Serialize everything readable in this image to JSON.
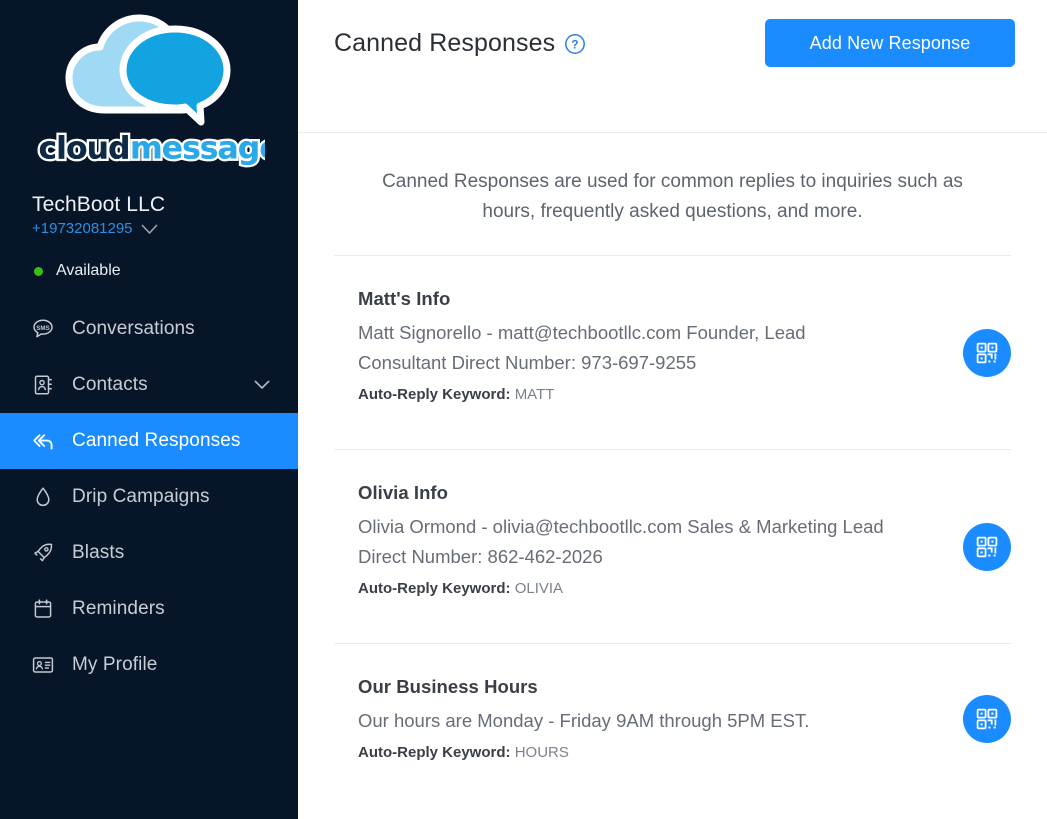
{
  "brand": {
    "logo_text_cloud": "cloud",
    "logo_text_message": "message",
    "logo_icon": "cloud-chat-logo",
    "accent_blue": "#1a8cff",
    "logo_light_blue": "#9ed9f5",
    "logo_dark_blue": "#0e2a47"
  },
  "sidebar": {
    "account_name": "TechBoot LLC",
    "account_phone": "+19732081295",
    "phone_chevron_icon": "chevron-down-icon",
    "status_label": "Available",
    "status_color": "#39c016",
    "items": [
      {
        "label": "Conversations",
        "icon": "sms-chat-icon",
        "active": false,
        "has_chevron": false
      },
      {
        "label": "Contacts",
        "icon": "address-book-icon",
        "active": false,
        "has_chevron": true
      },
      {
        "label": "Canned Responses",
        "icon": "reply-all-icon",
        "active": true,
        "has_chevron": false
      },
      {
        "label": "Drip Campaigns",
        "icon": "water-drop-icon",
        "active": false,
        "has_chevron": false
      },
      {
        "label": "Blasts",
        "icon": "rocket-icon",
        "active": false,
        "has_chevron": false
      },
      {
        "label": "Reminders",
        "icon": "calendar-icon",
        "active": false,
        "has_chevron": false
      },
      {
        "label": "My Profile",
        "icon": "id-card-icon",
        "active": false,
        "has_chevron": false
      }
    ]
  },
  "header": {
    "title": "Canned Responses",
    "help_icon": "question-mark-circle-icon",
    "add_button_label": "Add New Response"
  },
  "main": {
    "intro_text": "Canned Responses are used for common replies to inquiries such as hours, frequently asked questions, and more.",
    "keyword_label": "Auto-Reply Keyword:",
    "qr_icon": "qr-code-icon",
    "responses": [
      {
        "title": "Matt's Info",
        "body": "Matt Signorello - matt@techbootllc.com Founder, Lead Consultant Direct Number: 973-697-9255",
        "keyword": "MATT"
      },
      {
        "title": "Olivia Info",
        "body": "Olivia Ormond - olivia@techbootllc.com Sales & Marketing Lead Direct Number: 862-462-2026",
        "keyword": "OLIVIA"
      },
      {
        "title": "Our Business Hours",
        "body": "Our hours are Monday - Friday 9AM through 5PM EST.",
        "keyword": "HOURS"
      }
    ]
  }
}
